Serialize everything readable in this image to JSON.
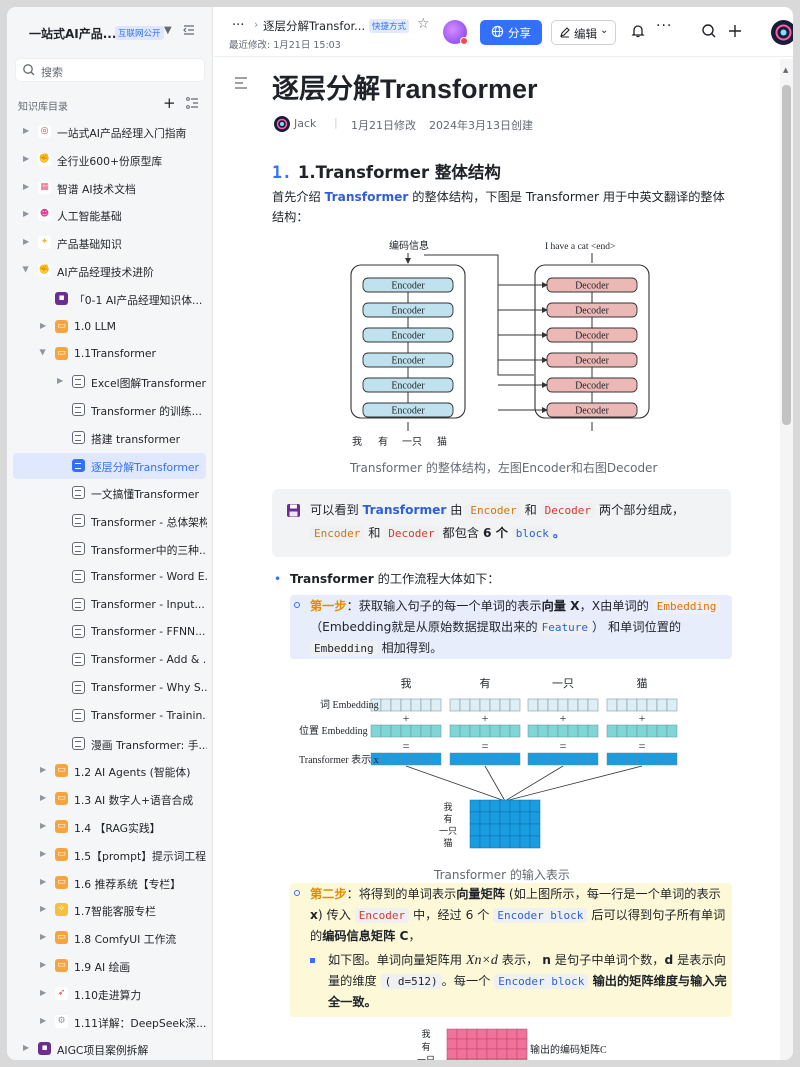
{
  "sidebar": {
    "title": "一站式AI产品...",
    "badge": "互联网公开",
    "search_placeholder": "搜索",
    "section_label": "知识库目录",
    "items": [
      {
        "label": "一站式AI产品经理入门指南",
        "icon": "target-emoji",
        "arrow": "collapsed"
      },
      {
        "label": "全行业600+份原型库",
        "icon": "flexed-arm-emoji",
        "arrow": "collapsed"
      },
      {
        "label": "智谱 AI技术文档",
        "icon": "calendar-emoji",
        "arrow": "collapsed"
      },
      {
        "label": "人工智能基础",
        "icon": "smiling-devil-emoji",
        "arrow": "collapsed"
      },
      {
        "label": "产品基础知识",
        "icon": "satellite-emoji",
        "arrow": "collapsed"
      },
      {
        "label": "AI产品经理技术进阶",
        "icon": "flexed-arm-emoji",
        "arrow": "expanded"
      },
      {
        "label": "「0-1 AI产品经理知识体...",
        "icon": "floppy-disk-emoji",
        "arrow": "none"
      },
      {
        "label": "1.0 LLM",
        "icon": "orange-folder-emoji",
        "arrow": "collapsed"
      },
      {
        "label": "1.1Transformer",
        "icon": "orange-folder-emoji",
        "arrow": "expanded"
      },
      {
        "label": "Excel图解Transformer",
        "icon": "document-icon",
        "arrow": "collapsed"
      },
      {
        "label": "Transformer 的训练...",
        "icon": "document-icon",
        "arrow": "none"
      },
      {
        "label": "搭建 transformer",
        "icon": "document-icon",
        "arrow": "none"
      },
      {
        "label": "逐层分解Transformer",
        "icon": "document-icon",
        "arrow": "none",
        "selected": true
      },
      {
        "label": "一文搞懂Transformer",
        "icon": "document-icon",
        "arrow": "none"
      },
      {
        "label": "Transformer - 总体架构",
        "icon": "document-icon",
        "arrow": "none"
      },
      {
        "label": "Transformer中的三种...",
        "icon": "document-icon",
        "arrow": "none"
      },
      {
        "label": "Transformer - Word E...",
        "icon": "document-icon",
        "arrow": "none"
      },
      {
        "label": "Transformer - Input...",
        "icon": "document-icon",
        "arrow": "none"
      },
      {
        "label": "Transformer - FFNN...",
        "icon": "document-icon",
        "arrow": "none"
      },
      {
        "label": "Transformer - Add & ...",
        "icon": "document-icon",
        "arrow": "none"
      },
      {
        "label": "Transformer - Why S...",
        "icon": "document-icon",
        "arrow": "none"
      },
      {
        "label": "Transformer - Trainin...",
        "icon": "document-icon",
        "arrow": "none"
      },
      {
        "label": "漫画 Transformer: 手...",
        "icon": "document-icon",
        "arrow": "none"
      },
      {
        "label": "1.2 AI Agents (智能体)",
        "icon": "orange-folder-emoji",
        "arrow": "collapsed"
      },
      {
        "label": "1.3 AI 数字人+语音合成",
        "icon": "orange-folder-emoji",
        "arrow": "collapsed"
      },
      {
        "label": "1.4 【RAG实践】",
        "icon": "orange-folder-emoji",
        "arrow": "collapsed"
      },
      {
        "label": "1.5【prompt】提示词工程",
        "icon": "orange-folder-emoji",
        "arrow": "collapsed"
      },
      {
        "label": "1.6 推荐系统【专栏】",
        "icon": "orange-folder-emoji",
        "arrow": "collapsed"
      },
      {
        "label": "1.7智能客服专栏",
        "icon": "lightbulb-emoji",
        "arrow": "collapsed"
      },
      {
        "label": "1.8 ComfyUI 工作流",
        "icon": "orange-folder-emoji",
        "arrow": "collapsed"
      },
      {
        "label": "1.9 AI 绘画",
        "icon": "orange-folder-emoji",
        "arrow": "collapsed"
      },
      {
        "label": "1.10走进算力",
        "icon": "rocket-emoji",
        "arrow": "collapsed"
      },
      {
        "label": "1.11详解：DeepSeek深...",
        "icon": "gear-emoji",
        "arrow": "collapsed"
      },
      {
        "label": "AIGC项目案例拆解",
        "icon": "floppy-disk-emoji",
        "arrow": "collapsed"
      }
    ]
  },
  "topbar": {
    "more": "···",
    "breadcrumb_title": "逐层分解Transfor...",
    "shortcut_badge": "快捷方式",
    "last_modified": "最近修改: 1月21日 15:03",
    "share_label": "分享",
    "edit_label": "编辑"
  },
  "doc": {
    "title": "逐层分解Transformer",
    "author": "Jack",
    "modified": "1月21日修改",
    "created": "2024年3月13日创建",
    "h2_num": "1.",
    "h2_text": "1.Transformer 整体结构",
    "intro_a": "首先介绍 ",
    "intro_b": "Transformer",
    "intro_c": " 的整体结构，下图是 Transformer 用于中英文翻译的整体结构：",
    "fig1": {
      "enc_title": "编码信息",
      "dec_title": "I have a cat <end>",
      "encoder": "Encoder",
      "decoder": "Decoder",
      "inputs": [
        "我",
        "有",
        "一只",
        "猫"
      ]
    },
    "caption1": "Transformer 的整体结构，左图Encoder和右图Decoder",
    "callout": {
      "a": "可以看到 ",
      "b": "Transformer",
      "c": " 由 ",
      "d": "Encoder",
      "e": " 和 ",
      "f": "Decoder",
      "g": " 两个部分组成，",
      "h": "Encoder",
      "i": " 和 ",
      "j": "Decoder",
      "k": " 都包含 ",
      "l": "6 个",
      "m": "block",
      "n": "。"
    },
    "bullet1_a": "Transformer",
    "bullet1_b": " 的工作流程大体如下：",
    "step1": {
      "label": "第一步",
      "a": "：获取输入句子的每一个单词的表示",
      "b": "向量 X",
      "c": "，X由单词的",
      "code1": "Embedding",
      "d": "（Embedding就是从原始数据提取出来的",
      "code2": "Feature",
      "e": "） 和单词位置的",
      "code3": "Embedding",
      "f": " 相加得到。"
    },
    "fig2": {
      "words": [
        "我",
        "有",
        "一只",
        "猫"
      ],
      "row1": "词 Embedding",
      "row2": "位置 Embedding",
      "row3": "Transformer 表示 x",
      "plus": "+",
      "eq": "=",
      "stack": [
        "我",
        "有",
        "一只",
        "猫"
      ]
    },
    "caption2": "Transformer 的输入表示",
    "step2": {
      "label": "第二步",
      "a": "：将得到的单词表示",
      "b": "向量矩阵",
      "c": " (如上图所示，每一行是一个单词的表示 ",
      "d": "x",
      "e": ") 传入 ",
      "code1": "Encoder",
      "f": " 中，经过 6 个 ",
      "code2": "Encoder block",
      "g": " 后可以得到句子所有单词的",
      "h": "编码信息矩阵 C",
      "i": "，"
    },
    "step2_sub": {
      "a": "如下图。单词向量矩阵用 ",
      "math": "Xn×d",
      "b": " 表示， ",
      "n": "n",
      "c": " 是句子中单词个数，",
      "d_bold": "d",
      "e": " 是表示向量的维度 ",
      "code1": "( d=512)",
      "f": "。每一个 ",
      "code2": "Encoder block",
      "g": " 输出的矩阵维度与输入完全一致。"
    },
    "fig3": {
      "stack": [
        "我",
        "有",
        "一只"
      ],
      "label": "输出的编码矩阵C"
    }
  }
}
